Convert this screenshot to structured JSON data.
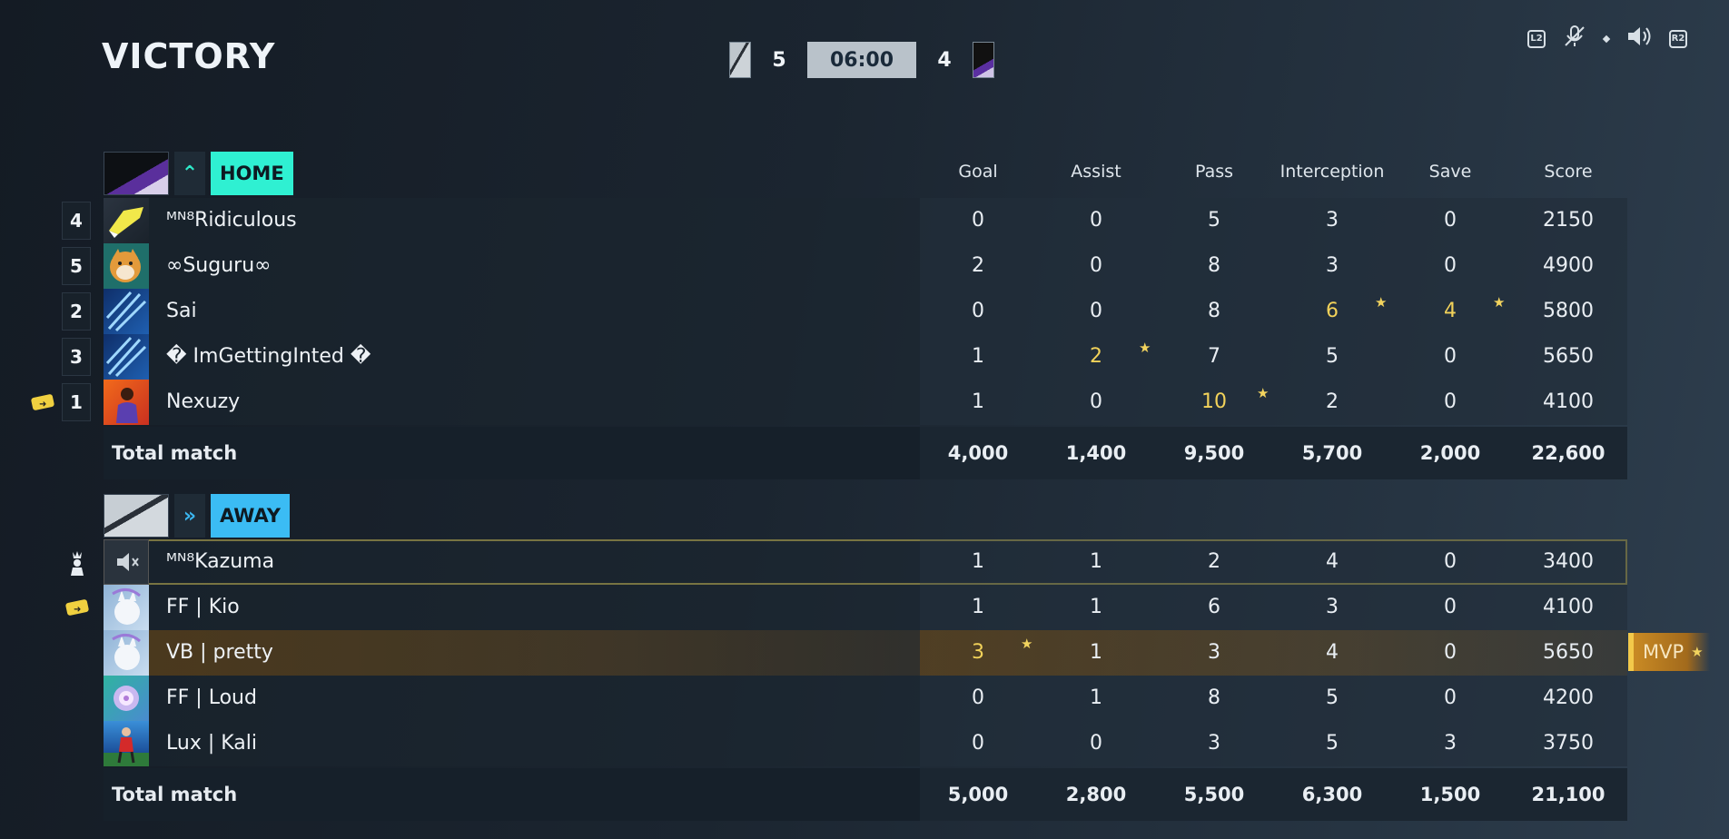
{
  "header": {
    "result": "VICTORY",
    "home_score": "5",
    "timer": "06:00",
    "away_score": "4"
  },
  "top_icons": {
    "l2": "L2",
    "r2": "R2",
    "mic": "mic-muted-icon",
    "speaker": "speaker-icon"
  },
  "columns": [
    "Goal",
    "Assist",
    "Pass",
    "Interception",
    "Save",
    "Score"
  ],
  "home": {
    "label": "HOME",
    "players": [
      {
        "rank": "4",
        "name": "ᴹᴺ⁸Ridiculous",
        "stats": [
          "0",
          "0",
          "5",
          "3",
          "0",
          "2150"
        ],
        "hl": []
      },
      {
        "rank": "5",
        "name": "∞Suguru∞",
        "stats": [
          "2",
          "0",
          "8",
          "3",
          "0",
          "4900"
        ],
        "hl": []
      },
      {
        "rank": "2",
        "name": "Sai",
        "stats": [
          "0",
          "0",
          "8",
          "6",
          "4",
          "5800"
        ],
        "hl": [
          3,
          4
        ]
      },
      {
        "rank": "3",
        "name": "� ImGettingInted �",
        "stats": [
          "1",
          "2",
          "7",
          "5",
          "0",
          "5650"
        ],
        "hl": [
          1
        ]
      },
      {
        "rank": "1",
        "name": "Nexuzy",
        "stats": [
          "1",
          "0",
          "10",
          "2",
          "0",
          "4100"
        ],
        "hl": [
          2
        ]
      }
    ],
    "total": {
      "label": "Total match",
      "values": [
        "4,000",
        "1,400",
        "9,500",
        "5,700",
        "2,000",
        "22,600"
      ]
    }
  },
  "away": {
    "label": "AWAY",
    "players": [
      {
        "name": "ᴹᴺ⁸Kazuma",
        "stats": [
          "1",
          "1",
          "2",
          "4",
          "0",
          "3400"
        ],
        "hl": []
      },
      {
        "name": "FF | Kio",
        "stats": [
          "1",
          "1",
          "6",
          "3",
          "0",
          "4100"
        ],
        "hl": []
      },
      {
        "name": "VB | pretty",
        "stats": [
          "3",
          "1",
          "3",
          "4",
          "0",
          "5650"
        ],
        "hl": [
          0
        ]
      },
      {
        "name": "FF | Loud",
        "stats": [
          "0",
          "1",
          "8",
          "5",
          "0",
          "4200"
        ],
        "hl": []
      },
      {
        "name": "Lux | Kali",
        "stats": [
          "0",
          "0",
          "3",
          "5",
          "3",
          "3750"
        ],
        "hl": []
      }
    ],
    "total": {
      "label": "Total match",
      "values": [
        "5,000",
        "2,800",
        "5,500",
        "6,300",
        "1,500",
        "21,100"
      ]
    }
  },
  "mvp_label": "MVP",
  "colors": {
    "home_accent": "#2ff0d2",
    "away_accent": "#3bbcf4",
    "highlight": "#f2d25a",
    "selection": "#e8d35a"
  }
}
